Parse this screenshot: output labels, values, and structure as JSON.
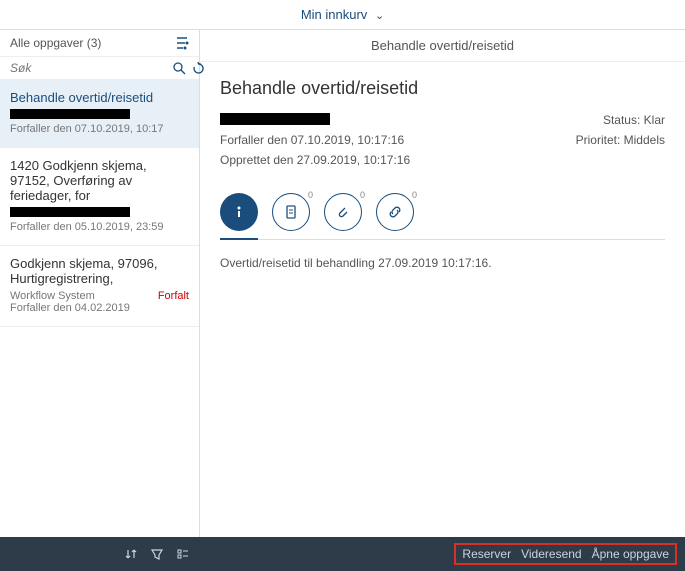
{
  "header": {
    "title": "Min innkurv"
  },
  "sidebar": {
    "tasks_label": "Alle oppgaver (3)",
    "search_placeholder": "Søk",
    "items": [
      {
        "title": "Behandle overtid/reisetid",
        "due": "Forfaller den 07.10.2019, 10:17"
      },
      {
        "title": "1420 Godkjenn skjema, 97152, Overføring av feriedager, for",
        "due": "Forfaller den 05.10.2019, 23:59"
      },
      {
        "title": "Godkjenn skjema, 97096, Hurtigregistrering,",
        "system": "Workflow System",
        "status": "Forfalt",
        "due": "Forfaller den 04.02.2019"
      }
    ]
  },
  "main": {
    "header": "Behandle overtid/reisetid",
    "title": "Behandle overtid/reisetid",
    "due": "Forfaller den 07.10.2019, 10:17:16",
    "created": "Opprettet den 27.09.2019, 10:17:16",
    "status_label": "Status:",
    "status_value": "Klar",
    "priority_label": "Prioritet:",
    "priority_value": "Middels",
    "tabs": {
      "clipboard_badge": "0",
      "attach_badge": "0",
      "link_badge": "0"
    },
    "note": "Overtid/reisetid til behandling 27.09.2019 10:17:16."
  },
  "footer": {
    "reserve": "Reserver",
    "forward": "Videresend",
    "open": "Åpne oppgave"
  }
}
